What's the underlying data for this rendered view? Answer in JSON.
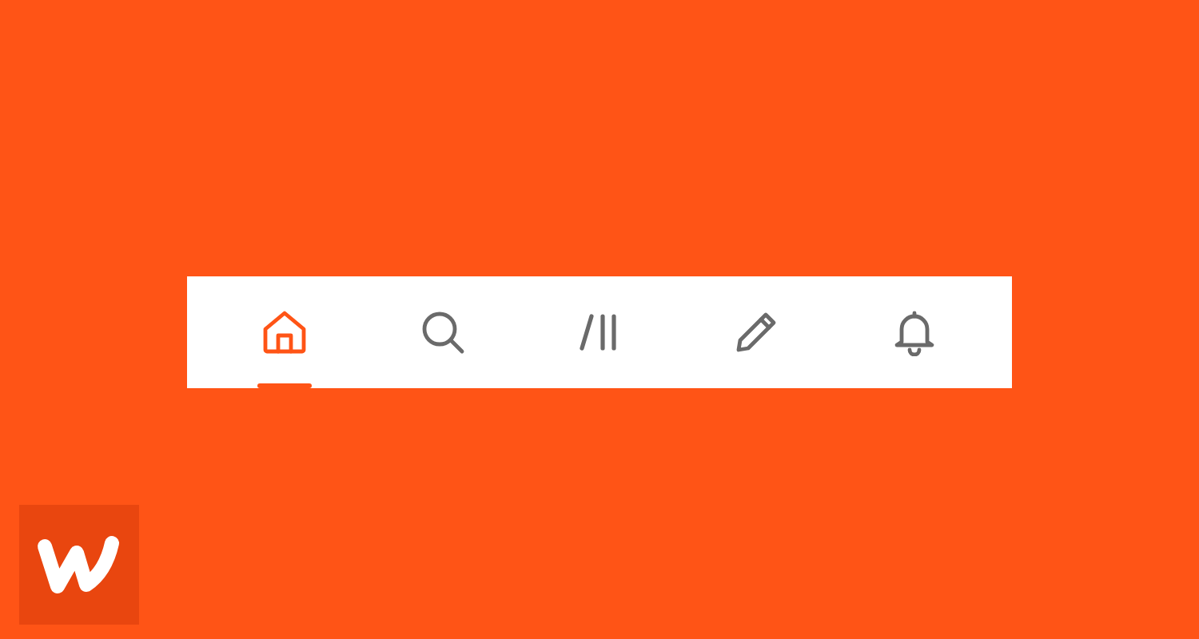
{
  "bottom_nav": {
    "items": [
      {
        "kind": "home",
        "selected": true
      },
      {
        "kind": "search",
        "selected": false
      },
      {
        "kind": "library",
        "selected": false
      },
      {
        "kind": "write",
        "selected": false
      },
      {
        "kind": "notifications",
        "selected": false
      }
    ]
  }
}
